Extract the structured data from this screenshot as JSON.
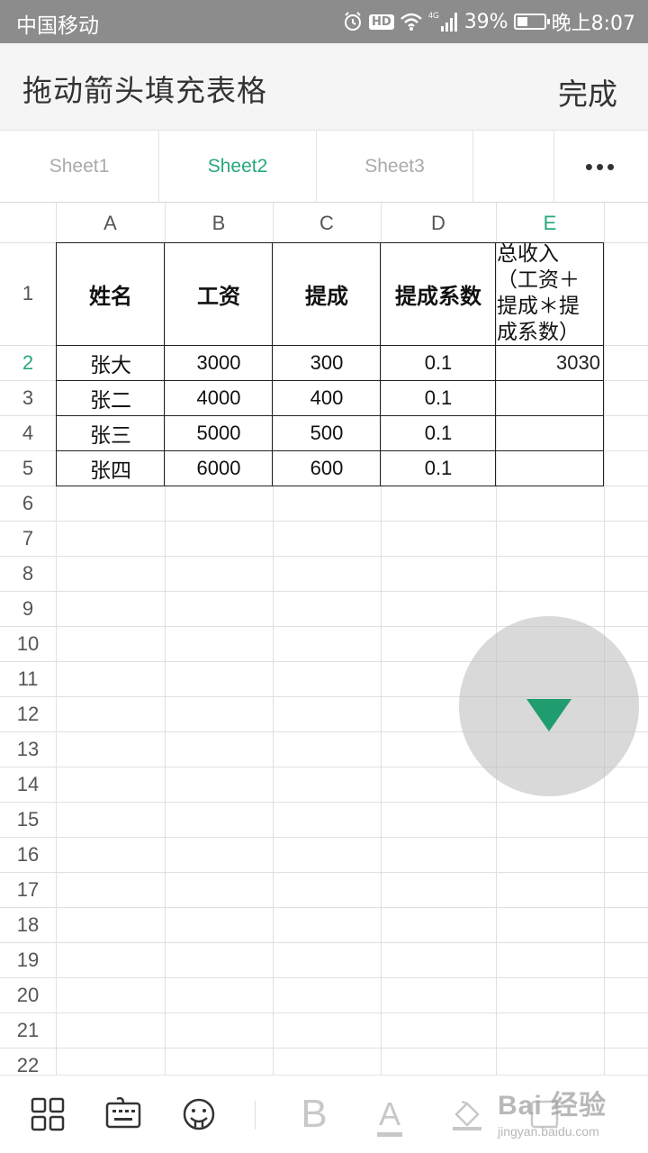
{
  "status_bar": {
    "carrier": "中国移动",
    "network": "4G",
    "battery": "39%",
    "battery_level": 0.39,
    "time": "晚上8:07",
    "icons": [
      "alarm-icon",
      "hd-icon",
      "wifi-icon",
      "signal-icon",
      "battery-icon"
    ]
  },
  "header": {
    "title": "拖动箭头填充表格",
    "done_label": "完成"
  },
  "sheet_tabs": {
    "tabs": [
      {
        "label": "Sheet1",
        "active": false
      },
      {
        "label": "Sheet2",
        "active": true
      },
      {
        "label": "Sheet3",
        "active": false
      }
    ],
    "more_label": "•••"
  },
  "grid": {
    "columns": [
      "A",
      "B",
      "C",
      "D",
      "E"
    ],
    "active_column": "E",
    "active_row": "2",
    "row_numbers": [
      "1",
      "2",
      "3",
      "4",
      "5",
      "6",
      "7",
      "8",
      "9",
      "10",
      "11",
      "12",
      "13",
      "14",
      "15",
      "16",
      "17",
      "18",
      "19",
      "20",
      "21",
      "22"
    ],
    "header_row": [
      "姓名",
      "工资",
      "提成",
      "提成系数",
      "总收入（工资＋提成＊提成系数）"
    ],
    "header_e_lines": [
      "总收入",
      "（工资＋",
      "提成＊提",
      "成系数）"
    ],
    "rows": [
      {
        "name": "张大",
        "salary": "3000",
        "commission": "300",
        "rate": "0.1",
        "total": "3030"
      },
      {
        "name": "张二",
        "salary": "4000",
        "commission": "400",
        "rate": "0.1",
        "total": ""
      },
      {
        "name": "张三",
        "salary": "5000",
        "commission": "500",
        "rate": "0.1",
        "total": ""
      },
      {
        "name": "张四",
        "salary": "6000",
        "commission": "600",
        "rate": "0.1",
        "total": ""
      }
    ]
  },
  "fill_handle": {
    "icon": "arrow-down-icon",
    "color": "#1f9d6f"
  },
  "toolbar": {
    "bold_label": "B",
    "font_color_label": "A",
    "icons": [
      "layout-grid-icon",
      "keyboard-icon",
      "face-icon",
      "bold-icon",
      "font-color-icon",
      "fill-color-icon",
      "more-icon"
    ]
  },
  "watermark": {
    "text": "Bai 经验",
    "sub": "jingyan.baidu.com"
  },
  "colors": {
    "accent": "#27a87a",
    "status_bar": "#8c8c8c",
    "title_bar": "#f5f5f5"
  }
}
